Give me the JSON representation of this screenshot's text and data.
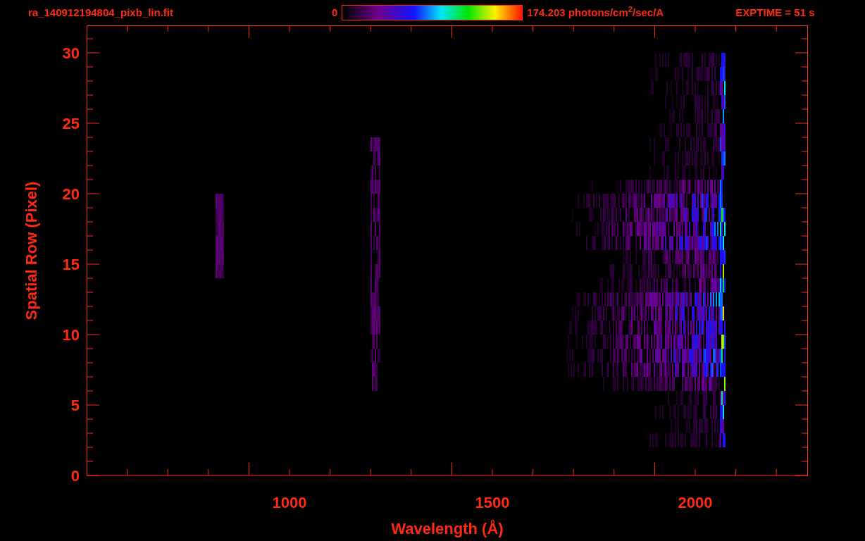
{
  "file_name": "ra_140912194804_pixb_lin.fit",
  "colorbar": {
    "min_label": "0",
    "max_label": "174.203 photons/cm$^{2}$/sec/A"
  },
  "exposure": "EXPTIME = 51 s",
  "plot": {
    "xlabel": "Wavelength (Å)",
    "ylabel": "Spatial Row (Pixel)",
    "xticks": [
      "1000",
      "1500",
      "2000"
    ],
    "yticks": [
      "30",
      "25",
      "20",
      "15",
      "10",
      "5",
      "0"
    ]
  }
}
